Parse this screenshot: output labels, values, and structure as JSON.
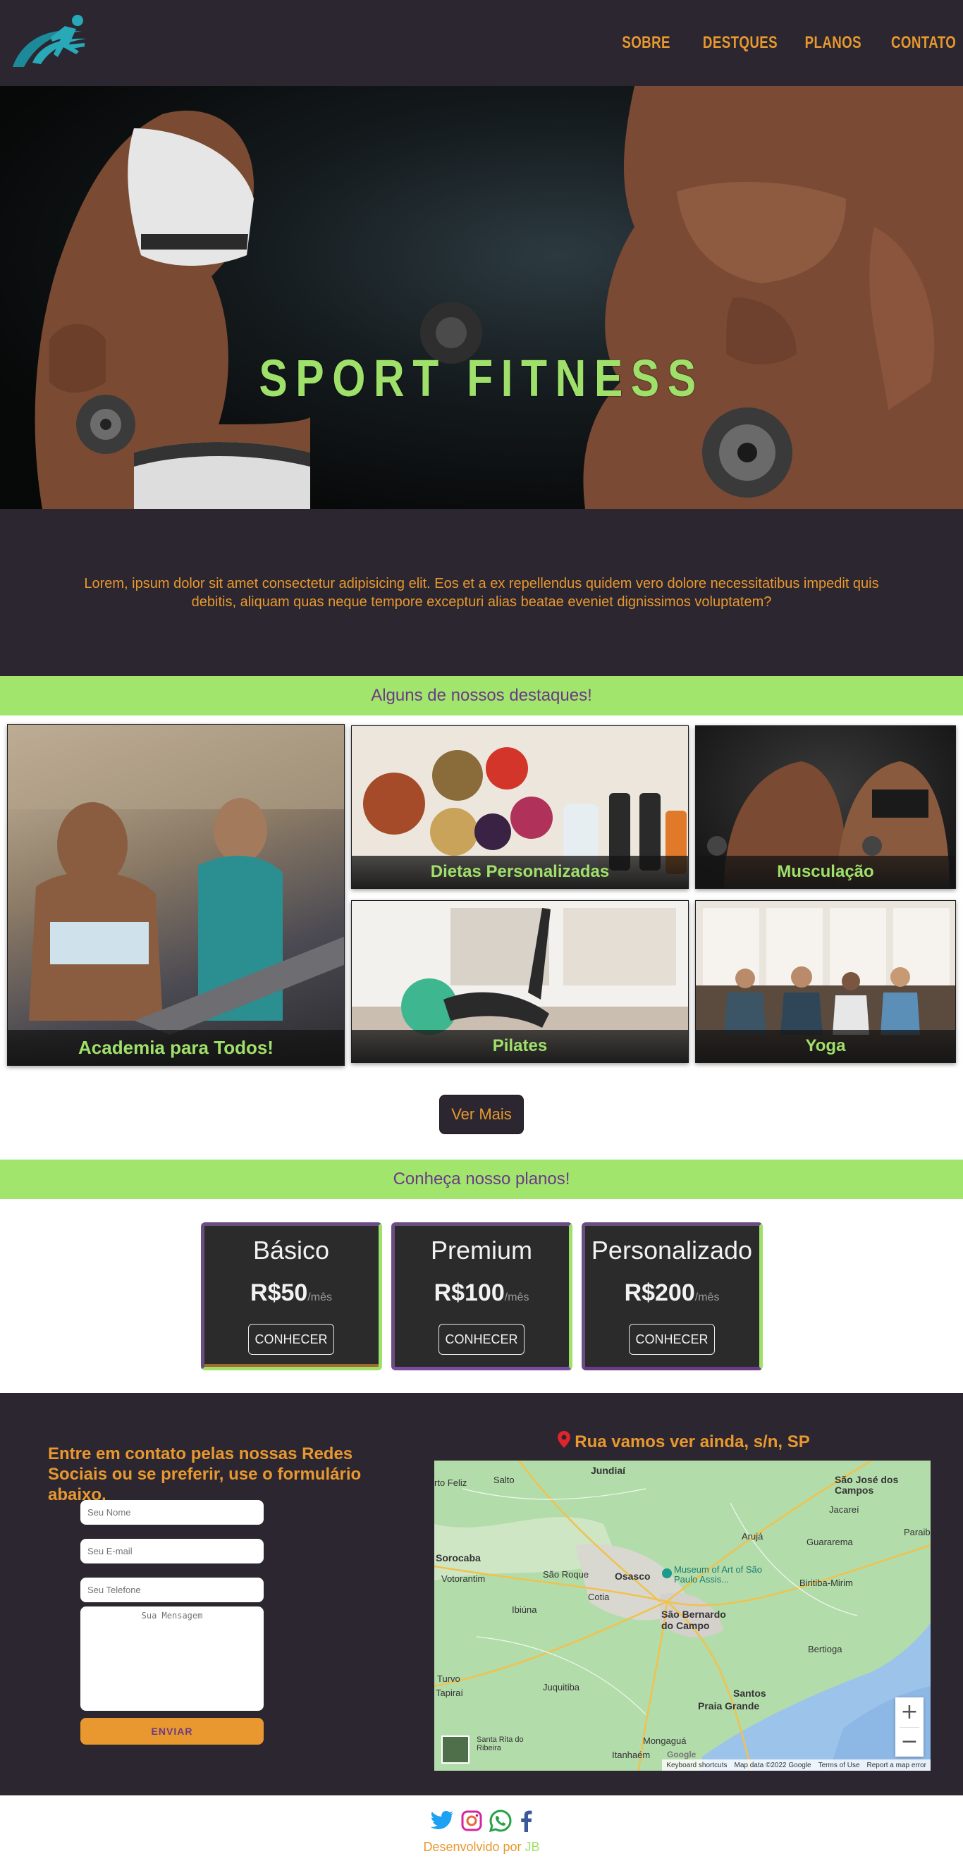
{
  "header": {
    "logo_icon": "runner-logo-icon",
    "nav": [
      {
        "label": "SOBRE"
      },
      {
        "label": "DESTQUES"
      },
      {
        "label": "PLANOS"
      },
      {
        "label": "CONTATO"
      }
    ]
  },
  "hero": {
    "title": "SPORT FITNESS"
  },
  "intro": {
    "text": "Lorem, ipsum dolor sit amet consectetur adipisicing elit. Eos et a ex repellendus quidem vero dolore necessitatibus impedit quis debitis, aliquam quas neque tempore excepturi alias beatae eveniet dignissimos voluptatem?"
  },
  "highlights": {
    "heading": "Alguns de nossos destaques!",
    "cards": [
      {
        "label": "Academia para Todos!"
      },
      {
        "label": "Dietas Personalizadas"
      },
      {
        "label": "Musculação"
      },
      {
        "label": "Pilates"
      },
      {
        "label": "Yoga"
      }
    ],
    "more_button": "Ver Mais"
  },
  "plans": {
    "heading": "Conheça nosso planos!",
    "items": [
      {
        "name": "Básico",
        "price": "R$50",
        "period": "/mês",
        "cta": "CONHECER"
      },
      {
        "name": "Premium",
        "price": "R$100",
        "period": "/mês",
        "cta": "CONHECER"
      },
      {
        "name": "Personalizado",
        "price": "R$200",
        "period": "/mês",
        "cta": "CONHECER"
      }
    ]
  },
  "contact": {
    "heading": "Entre em contato pelas nossas Redes Sociais ou se preferir, use o formulário abaixo.",
    "form": {
      "name_placeholder": "Seu Nome",
      "email_placeholder": "Seu E-mail",
      "phone_placeholder": "Seu Telefone",
      "message_placeholder": "Sua Mensagem",
      "submit": "ENVIAR"
    },
    "address": "Rua vamos ver ainda, s/n, SP",
    "map": {
      "places": [
        "Jundiaí",
        "São José dos Campos",
        "Salto",
        "Jacareí",
        "Sorocaba",
        "Arujá",
        "Guararema",
        "São Roque",
        "Osasco",
        "Votorantim",
        "Museum of Art of São Paulo Assis...",
        "Biritiba-Mirim",
        "Cotia",
        "Ibiúna",
        "São Bernardo do Campo",
        "Bertioga",
        "Turvo",
        "Juquitiba",
        "Tapiraí",
        "Santos",
        "Praia Grande",
        "Mongaguá",
        "Itanhaém",
        "Santa Rita do Ribeira",
        "Paraibu",
        "rto Feliz"
      ],
      "attribution": [
        "Keyboard shortcuts",
        "Map data ©2022 Google",
        "Terms of Use",
        "Report a map error"
      ],
      "google_mark": "Google"
    }
  },
  "footer": {
    "social_icons": [
      "twitter-icon",
      "instagram-icon",
      "whatsapp-icon",
      "facebook-icon"
    ],
    "credit_prefix": "Desenvolvido por",
    "credit_author": "JB"
  },
  "colors": {
    "dark_bg": "#2b2630",
    "accent_orange": "#e8982e",
    "accent_green": "#9fe06a",
    "accent_purple": "#6b3a86"
  }
}
